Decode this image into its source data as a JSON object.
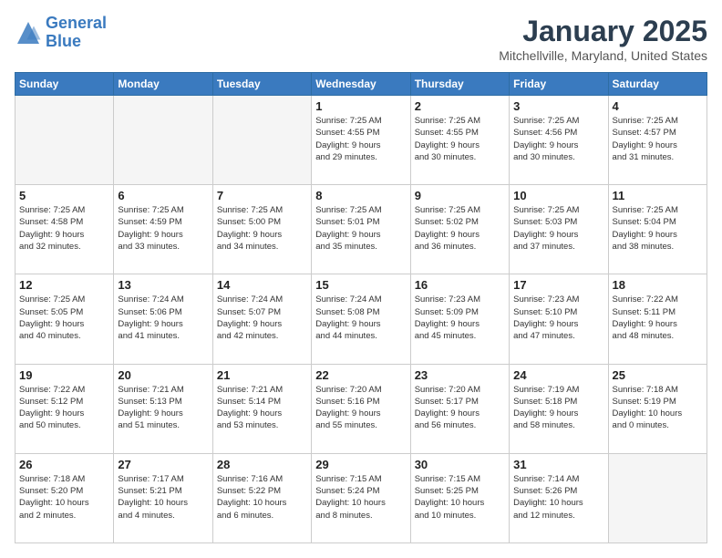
{
  "header": {
    "logo_line1": "General",
    "logo_line2": "Blue",
    "month": "January 2025",
    "location": "Mitchellville, Maryland, United States"
  },
  "days_of_week": [
    "Sunday",
    "Monday",
    "Tuesday",
    "Wednesday",
    "Thursday",
    "Friday",
    "Saturday"
  ],
  "weeks": [
    [
      {
        "day": "",
        "text": ""
      },
      {
        "day": "",
        "text": ""
      },
      {
        "day": "",
        "text": ""
      },
      {
        "day": "1",
        "text": "Sunrise: 7:25 AM\nSunset: 4:55 PM\nDaylight: 9 hours\nand 29 minutes."
      },
      {
        "day": "2",
        "text": "Sunrise: 7:25 AM\nSunset: 4:55 PM\nDaylight: 9 hours\nand 30 minutes."
      },
      {
        "day": "3",
        "text": "Sunrise: 7:25 AM\nSunset: 4:56 PM\nDaylight: 9 hours\nand 30 minutes."
      },
      {
        "day": "4",
        "text": "Sunrise: 7:25 AM\nSunset: 4:57 PM\nDaylight: 9 hours\nand 31 minutes."
      }
    ],
    [
      {
        "day": "5",
        "text": "Sunrise: 7:25 AM\nSunset: 4:58 PM\nDaylight: 9 hours\nand 32 minutes."
      },
      {
        "day": "6",
        "text": "Sunrise: 7:25 AM\nSunset: 4:59 PM\nDaylight: 9 hours\nand 33 minutes."
      },
      {
        "day": "7",
        "text": "Sunrise: 7:25 AM\nSunset: 5:00 PM\nDaylight: 9 hours\nand 34 minutes."
      },
      {
        "day": "8",
        "text": "Sunrise: 7:25 AM\nSunset: 5:01 PM\nDaylight: 9 hours\nand 35 minutes."
      },
      {
        "day": "9",
        "text": "Sunrise: 7:25 AM\nSunset: 5:02 PM\nDaylight: 9 hours\nand 36 minutes."
      },
      {
        "day": "10",
        "text": "Sunrise: 7:25 AM\nSunset: 5:03 PM\nDaylight: 9 hours\nand 37 minutes."
      },
      {
        "day": "11",
        "text": "Sunrise: 7:25 AM\nSunset: 5:04 PM\nDaylight: 9 hours\nand 38 minutes."
      }
    ],
    [
      {
        "day": "12",
        "text": "Sunrise: 7:25 AM\nSunset: 5:05 PM\nDaylight: 9 hours\nand 40 minutes."
      },
      {
        "day": "13",
        "text": "Sunrise: 7:24 AM\nSunset: 5:06 PM\nDaylight: 9 hours\nand 41 minutes."
      },
      {
        "day": "14",
        "text": "Sunrise: 7:24 AM\nSunset: 5:07 PM\nDaylight: 9 hours\nand 42 minutes."
      },
      {
        "day": "15",
        "text": "Sunrise: 7:24 AM\nSunset: 5:08 PM\nDaylight: 9 hours\nand 44 minutes."
      },
      {
        "day": "16",
        "text": "Sunrise: 7:23 AM\nSunset: 5:09 PM\nDaylight: 9 hours\nand 45 minutes."
      },
      {
        "day": "17",
        "text": "Sunrise: 7:23 AM\nSunset: 5:10 PM\nDaylight: 9 hours\nand 47 minutes."
      },
      {
        "day": "18",
        "text": "Sunrise: 7:22 AM\nSunset: 5:11 PM\nDaylight: 9 hours\nand 48 minutes."
      }
    ],
    [
      {
        "day": "19",
        "text": "Sunrise: 7:22 AM\nSunset: 5:12 PM\nDaylight: 9 hours\nand 50 minutes."
      },
      {
        "day": "20",
        "text": "Sunrise: 7:21 AM\nSunset: 5:13 PM\nDaylight: 9 hours\nand 51 minutes."
      },
      {
        "day": "21",
        "text": "Sunrise: 7:21 AM\nSunset: 5:14 PM\nDaylight: 9 hours\nand 53 minutes."
      },
      {
        "day": "22",
        "text": "Sunrise: 7:20 AM\nSunset: 5:16 PM\nDaylight: 9 hours\nand 55 minutes."
      },
      {
        "day": "23",
        "text": "Sunrise: 7:20 AM\nSunset: 5:17 PM\nDaylight: 9 hours\nand 56 minutes."
      },
      {
        "day": "24",
        "text": "Sunrise: 7:19 AM\nSunset: 5:18 PM\nDaylight: 9 hours\nand 58 minutes."
      },
      {
        "day": "25",
        "text": "Sunrise: 7:18 AM\nSunset: 5:19 PM\nDaylight: 10 hours\nand 0 minutes."
      }
    ],
    [
      {
        "day": "26",
        "text": "Sunrise: 7:18 AM\nSunset: 5:20 PM\nDaylight: 10 hours\nand 2 minutes."
      },
      {
        "day": "27",
        "text": "Sunrise: 7:17 AM\nSunset: 5:21 PM\nDaylight: 10 hours\nand 4 minutes."
      },
      {
        "day": "28",
        "text": "Sunrise: 7:16 AM\nSunset: 5:22 PM\nDaylight: 10 hours\nand 6 minutes."
      },
      {
        "day": "29",
        "text": "Sunrise: 7:15 AM\nSunset: 5:24 PM\nDaylight: 10 hours\nand 8 minutes."
      },
      {
        "day": "30",
        "text": "Sunrise: 7:15 AM\nSunset: 5:25 PM\nDaylight: 10 hours\nand 10 minutes."
      },
      {
        "day": "31",
        "text": "Sunrise: 7:14 AM\nSunset: 5:26 PM\nDaylight: 10 hours\nand 12 minutes."
      },
      {
        "day": "",
        "text": ""
      }
    ]
  ]
}
